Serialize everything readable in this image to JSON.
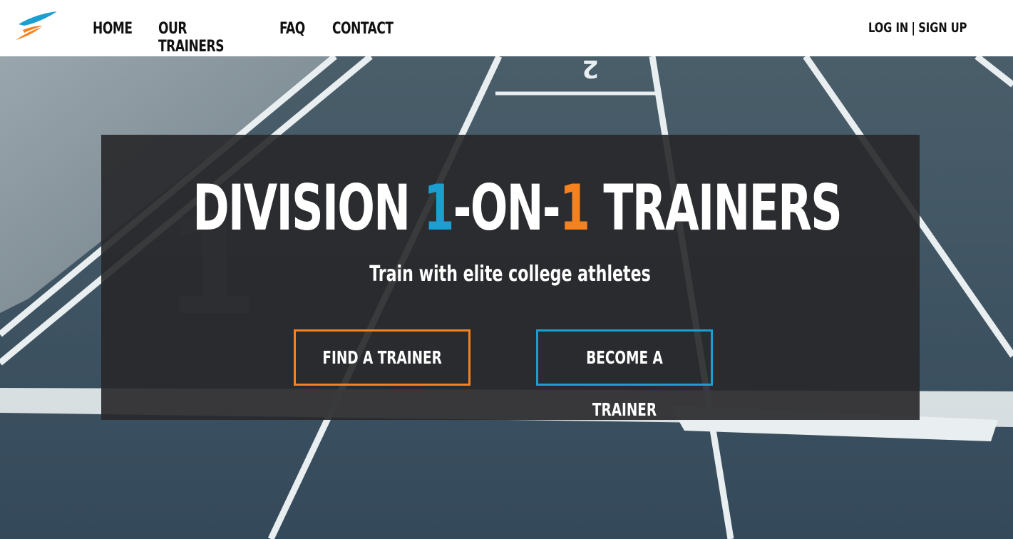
{
  "brand": {
    "logo_icon": "runner-swoosh-logo",
    "colors": {
      "blue": "#1a9fd0",
      "orange": "#f58220"
    }
  },
  "nav": {
    "items": [
      {
        "label": "HOME"
      },
      {
        "label": "OUR TRAINERS"
      },
      {
        "label": "FAQ"
      },
      {
        "label": "CONTACT"
      }
    ],
    "login_label": "LOG IN",
    "separator": "|",
    "signup_label": "SIGN UP"
  },
  "hero": {
    "headline": {
      "part1": "DIVISION ",
      "one_a": "1",
      "mid": "-ON-",
      "one_b": "1",
      "part2": " TRAINERS"
    },
    "subtitle": "Train with elite college athletes",
    "find_button": "FIND A TRAINER",
    "become_button": "BECOME A TRAINER"
  }
}
